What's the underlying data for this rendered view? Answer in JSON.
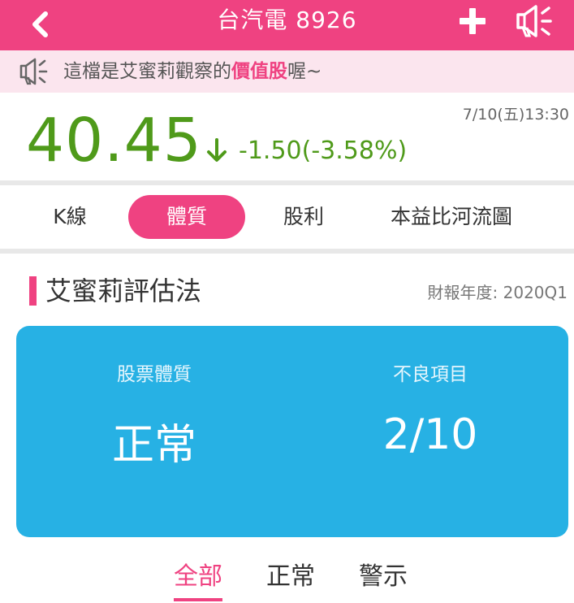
{
  "header": {
    "title": "台汽電 8926",
    "back_icon": "chevron-left-icon",
    "add_icon": "plus-icon",
    "share_icon": "megaphone-icon"
  },
  "notice": {
    "icon": "megaphone-icon",
    "text_before": "這檔是艾蜜莉觀察的",
    "highlight": "價值股",
    "text_after": "喔~"
  },
  "quote": {
    "price": "40.45",
    "change": "-1.50(-3.58%)",
    "datetime": "7/10(五)13:30",
    "direction_icon": "arrow-down-icon"
  },
  "tabs": [
    {
      "label": "K線",
      "active": false
    },
    {
      "label": "體質",
      "active": true
    },
    {
      "label": "股利",
      "active": false
    },
    {
      "label": "本益比河流圖",
      "active": false
    }
  ],
  "section": {
    "title": "艾蜜莉評估法",
    "report_period": "財報年度: 2020Q1"
  },
  "summary": {
    "health_label": "股票體質",
    "health_value": "正常",
    "bad_items_label": "不良項目",
    "bad_items_value": "2/10"
  },
  "filters": [
    {
      "label": "全部",
      "active": true
    },
    {
      "label": "正常",
      "active": false
    },
    {
      "label": "警示",
      "active": false
    }
  ],
  "colors": {
    "brand_pink": "#ef4281",
    "notice_bg": "#fbe5ee",
    "price_green": "#4f9a1a",
    "card_blue": "#27b1e4"
  }
}
